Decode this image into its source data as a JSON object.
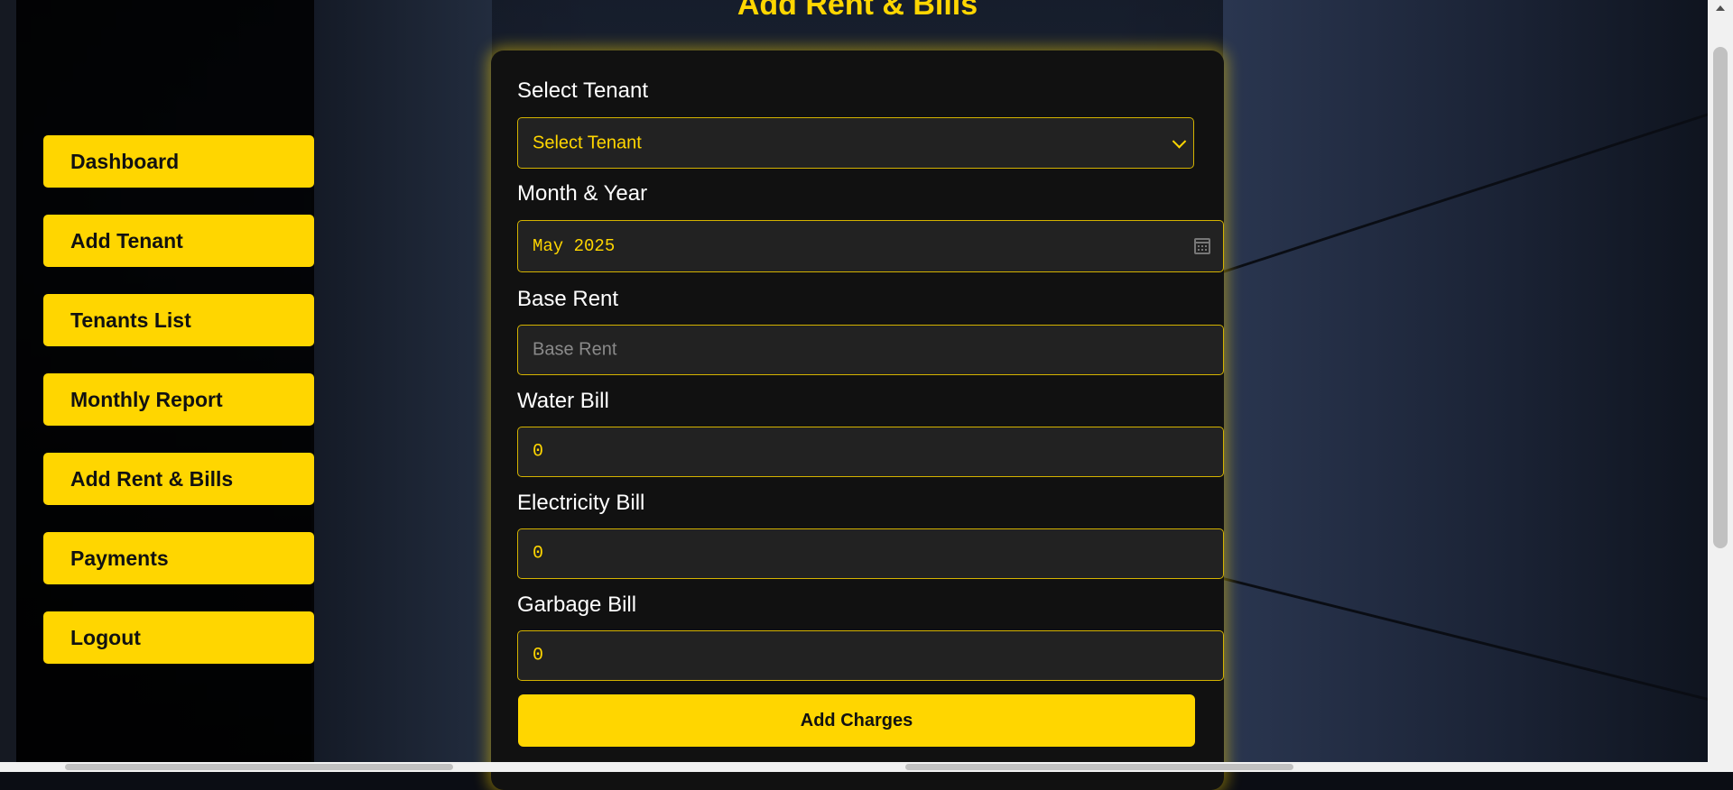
{
  "page": {
    "title": "Add Rent & Bills"
  },
  "sidebar": {
    "items": [
      {
        "label": "Dashboard"
      },
      {
        "label": "Add Tenant"
      },
      {
        "label": "Tenants List"
      },
      {
        "label": "Monthly Report"
      },
      {
        "label": "Add Rent & Bills"
      },
      {
        "label": "Payments"
      },
      {
        "label": "Logout"
      }
    ]
  },
  "form": {
    "tenant": {
      "label": "Select Tenant",
      "selected": "Select Tenant"
    },
    "month": {
      "label": "Month & Year",
      "value": "May 2025"
    },
    "base_rent": {
      "label": "Base Rent",
      "placeholder": "Base Rent",
      "value": ""
    },
    "water_bill": {
      "label": "Water Bill",
      "value": "0"
    },
    "electricity_bill": {
      "label": "Electricity Bill",
      "value": "0"
    },
    "garbage_bill": {
      "label": "Garbage Bill",
      "value": "0"
    },
    "submit_label": "Add Charges"
  },
  "colors": {
    "accent": "#ffd600",
    "panel": "#111111",
    "field_bg": "#222222"
  },
  "icons": {
    "select_chevron": "chevron-down-icon",
    "calendar": "calendar-icon"
  }
}
